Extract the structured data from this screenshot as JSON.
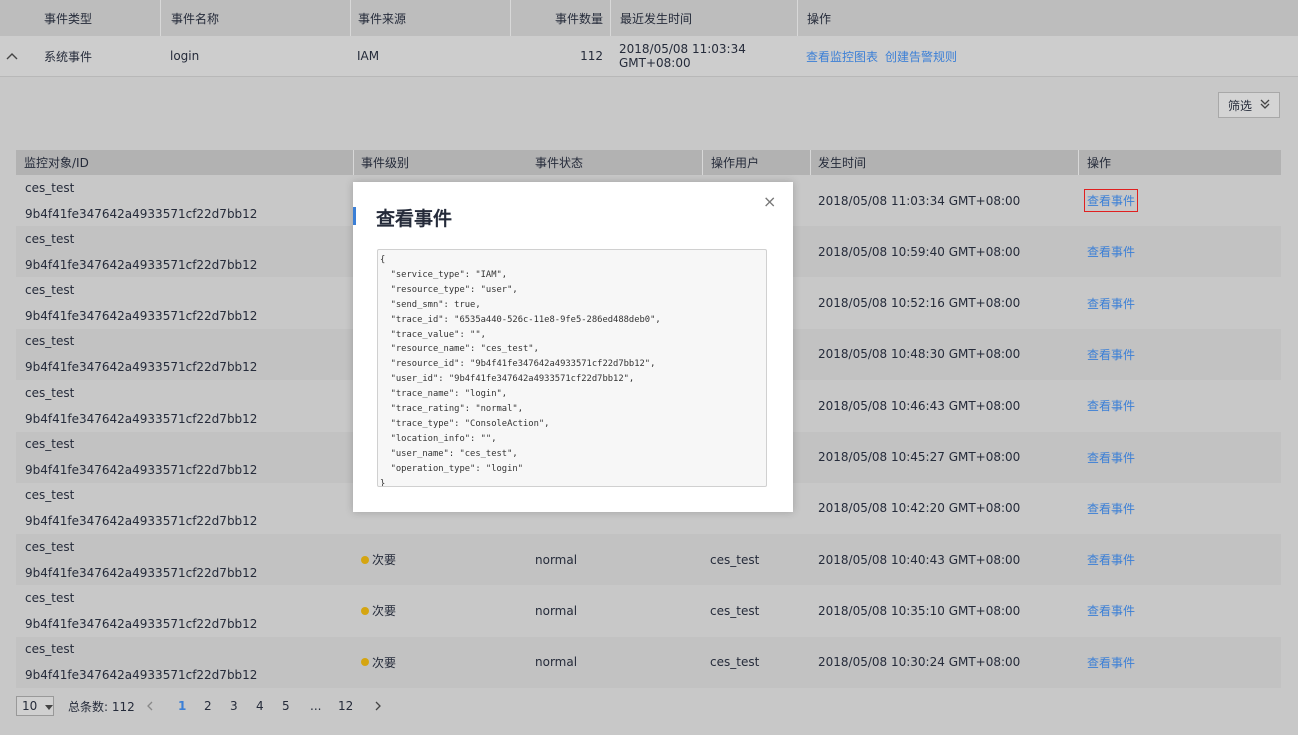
{
  "top_table": {
    "headers": [
      "事件类型",
      "事件名称",
      "事件来源",
      "事件数量",
      "最近发生时间",
      "操作"
    ],
    "row": {
      "type": "系统事件",
      "name": "login",
      "source": "IAM",
      "count": "112",
      "time": "2018/05/08 11:03:34 GMT+08:00",
      "action1": "查看监控图表",
      "action2": "创建告警规则"
    }
  },
  "filter": {
    "label": "筛选"
  },
  "events_table": {
    "headers": [
      "监控对象/ID",
      "事件级别",
      "事件状态",
      "操作用户",
      "发生时间",
      "操作"
    ],
    "rows": [
      {
        "obj": "ces_test",
        "id": "9b4f41fe347642a4933571cf22d7bb12",
        "level": "",
        "status": "",
        "user": "",
        "time": "2018/05/08 11:03:34 GMT+08:00",
        "action": "查看事件"
      },
      {
        "obj": "ces_test",
        "id": "9b4f41fe347642a4933571cf22d7bb12",
        "level": "",
        "status": "",
        "user": "",
        "time": "2018/05/08 10:59:40 GMT+08:00",
        "action": "查看事件"
      },
      {
        "obj": "ces_test",
        "id": "9b4f41fe347642a4933571cf22d7bb12",
        "level": "",
        "status": "",
        "user": "",
        "time": "2018/05/08 10:52:16 GMT+08:00",
        "action": "查看事件"
      },
      {
        "obj": "ces_test",
        "id": "9b4f41fe347642a4933571cf22d7bb12",
        "level": "",
        "status": "",
        "user": "",
        "time": "2018/05/08 10:48:30 GMT+08:00",
        "action": "查看事件"
      },
      {
        "obj": "ces_test",
        "id": "9b4f41fe347642a4933571cf22d7bb12",
        "level": "",
        "status": "",
        "user": "",
        "time": "2018/05/08 10:46:43 GMT+08:00",
        "action": "查看事件"
      },
      {
        "obj": "ces_test",
        "id": "9b4f41fe347642a4933571cf22d7bb12",
        "level": "",
        "status": "",
        "user": "",
        "time": "2018/05/08 10:45:27 GMT+08:00",
        "action": "查看事件"
      },
      {
        "obj": "ces_test",
        "id": "9b4f41fe347642a4933571cf22d7bb12",
        "level": "",
        "status": "",
        "user": "",
        "time": "2018/05/08 10:42:20 GMT+08:00",
        "action": "查看事件"
      },
      {
        "obj": "ces_test",
        "id": "9b4f41fe347642a4933571cf22d7bb12",
        "level": "次要",
        "status": "normal",
        "user": "ces_test",
        "time": "2018/05/08 10:40:43 GMT+08:00",
        "action": "查看事件"
      },
      {
        "obj": "ces_test",
        "id": "9b4f41fe347642a4933571cf22d7bb12",
        "level": "次要",
        "status": "normal",
        "user": "ces_test",
        "time": "2018/05/08 10:35:10 GMT+08:00",
        "action": "查看事件"
      },
      {
        "obj": "ces_test",
        "id": "9b4f41fe347642a4933571cf22d7bb12",
        "level": "次要",
        "status": "normal",
        "user": "ces_test",
        "time": "2018/05/08 10:30:24 GMT+08:00",
        "action": "查看事件"
      }
    ]
  },
  "pagination": {
    "page_size": "10",
    "total": "总条数: 112",
    "pages": [
      "1",
      "2",
      "3",
      "4",
      "5",
      "...",
      "12"
    ],
    "current": "1"
  },
  "modal": {
    "title": "查看事件",
    "close": "×",
    "json_lines": [
      "{",
      "  \"service_type\": \"IAM\",",
      "  \"resource_type\": \"user\",",
      "  \"send_smn\": true,",
      "  \"trace_id\": \"6535a440-526c-11e8-9fe5-286ed488deb0\",",
      "  \"trace_value\": \"\",",
      "  \"resource_name\": \"ces_test\",",
      "  \"resource_id\": \"9b4f41fe347642a4933571cf22d7bb12\",",
      "  \"user_id\": \"9b4f41fe347642a4933571cf22d7bb12\",",
      "  \"trace_name\": \"login\",",
      "  \"trace_rating\": \"normal\",",
      "  \"trace_type\": \"ConsoleAction\",",
      "  \"location_info\": \"\",",
      "  \"user_name\": \"ces_test\",",
      "  \"operation_type\": \"login\"",
      "}"
    ]
  },
  "colors": {
    "link": "#3b7fd6",
    "minor_dot": "#d5a511",
    "highlight": "#e02020"
  }
}
